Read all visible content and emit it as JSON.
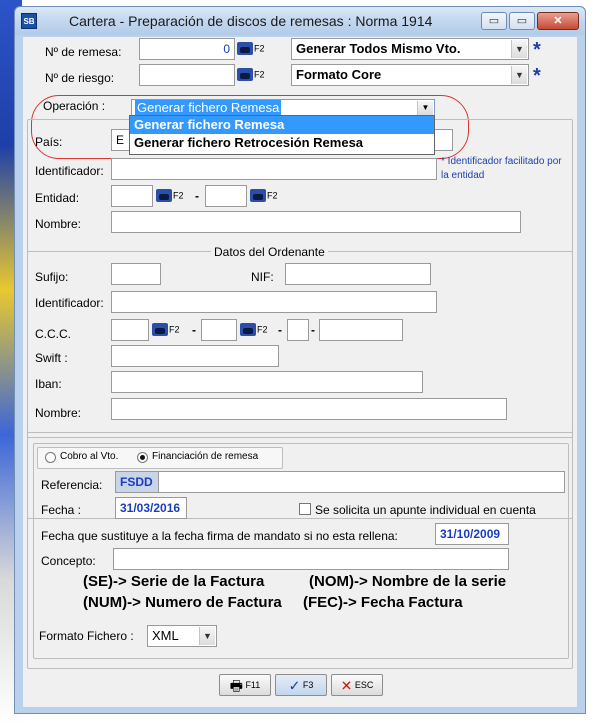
{
  "window": {
    "title": "Cartera - Preparación de discos de remesas : Norma 1914",
    "icon_text": "SB"
  },
  "title_buttons": {
    "minimize": "▭",
    "maximize": "▭",
    "close": "✕"
  },
  "header": {
    "remesa_label": "Nº de remesa:",
    "remesa_value": "0",
    "riesgo_label": "Nº de riesgo:",
    "riesgo_value": "",
    "f2": "F2",
    "vto_select": "Generar Todos Mismo Vto.",
    "formato_select": "Formato Core",
    "required_mark": "*"
  },
  "operacion": {
    "label": "Operación :",
    "selected": "Generar fichero Remesa",
    "options": [
      "Generar fichero Remesa",
      "Generar fichero Retrocesión Remesa"
    ]
  },
  "entidad_group": {
    "pais_label": "País:",
    "pais_value": "E",
    "identificador_label": "Identificador:",
    "identificador_hint": "* Identificador facilitado por la entidad",
    "entidad_label": "Entidad:",
    "nombre_label": "Nombre:",
    "dash": "-"
  },
  "ordenante": {
    "title": "Datos del Ordenante",
    "sufijo_label": "Sufijo:",
    "nif_label": "NIF:",
    "identificador_label": "Identificador:",
    "ccc_label": "C.C.C.",
    "swift_label": "Swift :",
    "iban_label": "Iban:",
    "nombre_label": "Nombre:"
  },
  "cobro": {
    "radio_cobro": "Cobro al Vto.",
    "radio_financiacion": "Financiación de remesa",
    "referencia_label": "Referencia:",
    "referencia_value": "FSDD",
    "fecha_label": "Fecha :",
    "fecha_value": "31/03/2016",
    "apunte_label": "Se solicita un apunte individual en cuenta",
    "fecha_sust_label": "Fecha que sustituye a la fecha firma de mandato si no esta rellena:",
    "fecha_sust_value": "31/10/2009",
    "concepto_label": "Concepto:",
    "legend_se": "(SE)-> Serie de la Factura",
    "legend_nom": "(NOM)-> Nombre de la serie",
    "legend_num": "(NUM)-> Numero de Factura",
    "legend_fec": "(FEC)-> Fecha Factura",
    "formato_label": "Formato Fichero :",
    "formato_value": "XML"
  },
  "footer": {
    "print": "F11",
    "accept": "F3",
    "escape": "ESC"
  }
}
